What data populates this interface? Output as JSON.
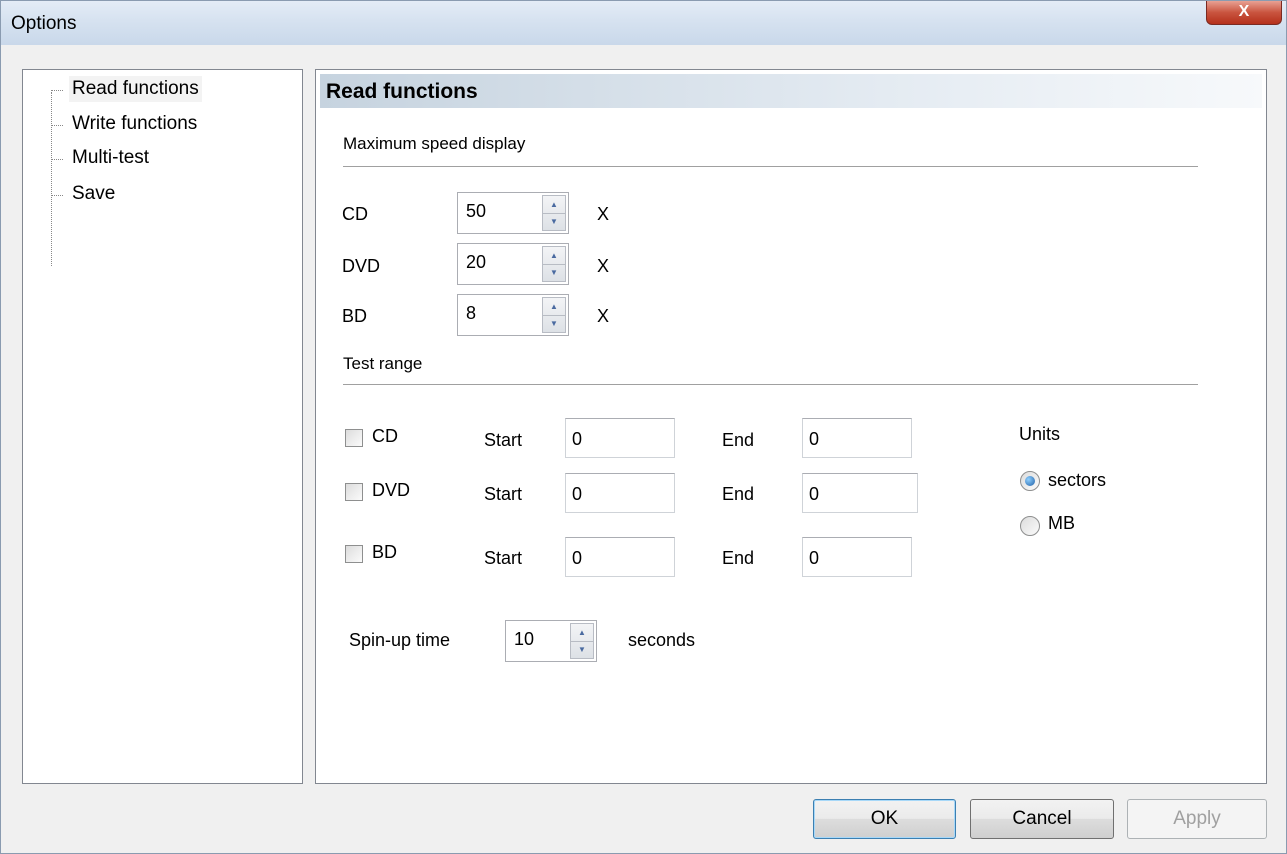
{
  "window": {
    "title": "Options",
    "close_label": "X"
  },
  "tree": {
    "items": [
      {
        "label": "Read functions",
        "selected": true
      },
      {
        "label": "Write functions"
      },
      {
        "label": "Multi-test"
      },
      {
        "label": "Save"
      }
    ]
  },
  "panel": {
    "header": "Read functions",
    "max_speed": {
      "title": "Maximum speed display",
      "rows": [
        {
          "label": "CD",
          "value": "50",
          "unit": "X"
        },
        {
          "label": "DVD",
          "value": "20",
          "unit": "X"
        },
        {
          "label": "BD",
          "value": "8",
          "unit": "X"
        }
      ]
    },
    "test_range": {
      "title": "Test range",
      "start_label": "Start",
      "end_label": "End",
      "rows": [
        {
          "label": "CD",
          "checked": false,
          "start": "0",
          "end": "0"
        },
        {
          "label": "DVD",
          "checked": false,
          "start": "0",
          "end": "0"
        },
        {
          "label": "BD",
          "checked": false,
          "start": "0",
          "end": "0"
        }
      ],
      "units": {
        "title": "Units",
        "options": [
          {
            "label": "sectors",
            "selected": true
          },
          {
            "label": "MB",
            "selected": false
          }
        ]
      }
    },
    "spinup": {
      "label": "Spin-up time",
      "value": "10",
      "unit": "seconds"
    }
  },
  "buttons": {
    "ok": "OK",
    "cancel": "Cancel",
    "apply": "Apply"
  },
  "colors": {
    "accent": "#1f5fa6",
    "close": "#c9543f"
  }
}
